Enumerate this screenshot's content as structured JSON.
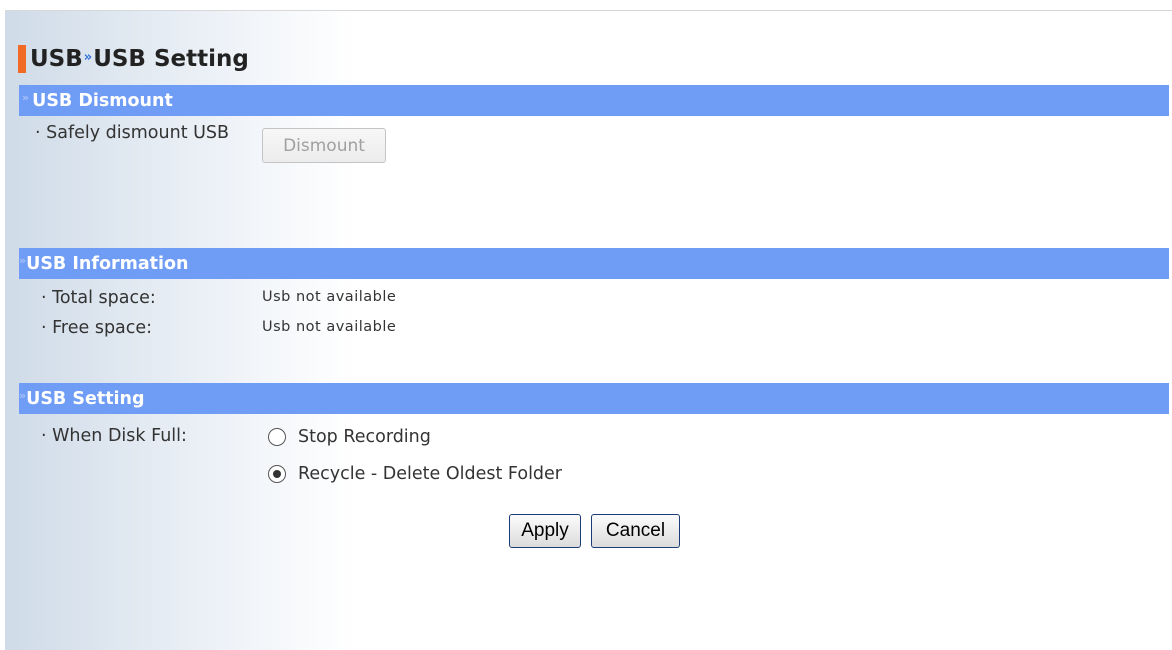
{
  "header": {
    "section": "USB",
    "separator": "»",
    "page": "USB Setting"
  },
  "dismount": {
    "title": "USB Dismount",
    "label": "· Safely dismount USB",
    "button_label": "Dismount"
  },
  "information": {
    "title": "USB Information",
    "total_label": "· Total space:",
    "total_value": "Usb not available",
    "free_label": "· Free space:",
    "free_value": "Usb not available"
  },
  "setting": {
    "title": "USB Setting",
    "disk_full_label": "· When Disk Full:",
    "options": [
      {
        "label": "Stop Recording",
        "selected": false
      },
      {
        "label": "Recycle - Delete Oldest Folder",
        "selected": true
      }
    ]
  },
  "actions": {
    "apply_label": "Apply",
    "cancel_label": "Cancel"
  },
  "colors": {
    "accent": "#f26b25",
    "section_bar": "#6f9cf4"
  },
  "icons": {
    "chevron": "double-chevron-right-icon"
  }
}
